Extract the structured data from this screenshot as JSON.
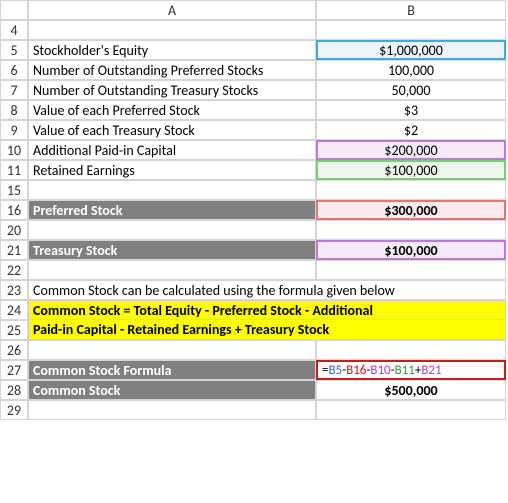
{
  "columns": {
    "rowcol": "",
    "A": "A",
    "B": "B"
  },
  "rows": {
    "4": {
      "A": "",
      "B": ""
    },
    "5": {
      "A": "Stockholder's Equity",
      "B": "$1,000,000"
    },
    "6": {
      "A": "Number of Outstanding Preferred Stocks",
      "B": "100,000"
    },
    "7": {
      "A": "Number of Outstanding Treasury Stocks",
      "B": "50,000"
    },
    "8": {
      "A": "Value of each Preferred Stock",
      "B": "$3"
    },
    "9": {
      "A": "Value of each Treasury Stock",
      "B": "$2"
    },
    "10": {
      "A": "Additional Paid-in Capital",
      "B": "$200,000"
    },
    "11": {
      "A": "Retained Earnings",
      "B": "$100,000"
    },
    "15": {
      "A": "",
      "B": ""
    },
    "16": {
      "A": "Preferred Stock",
      "B": "$300,000"
    },
    "20": {
      "A": "",
      "B": ""
    },
    "21": {
      "A": "Treasury Stock",
      "B": "$100,000"
    },
    "22": {
      "A": "",
      "B": ""
    },
    "23": {
      "A": "Common Stock can be calculated using the formula given below",
      "B": ""
    },
    "24": {
      "A": "Common Stock = Total Equity - Preferred Stock - Additional ",
      "B": ""
    },
    "25": {
      "A": "Paid-in Capital - Retained Earnings + Treasury Stock",
      "B": ""
    },
    "26": {
      "A": "",
      "B": ""
    },
    "27": {
      "A": "Common Stock Formula",
      "B_formula": {
        "eq": "=",
        "parts": [
          "B5",
          "-",
          "B16",
          "-",
          "B10",
          "-",
          "B11",
          "+",
          "B21"
        ]
      }
    },
    "28": {
      "A": "Common Stock",
      "B": "$500,000"
    },
    "29": {
      "A": "",
      "B": ""
    }
  },
  "chart_data": {
    "type": "table",
    "title": "Common Stock Calculation",
    "inputs": {
      "Stockholder's Equity": 1000000,
      "Number of Outstanding Preferred Stocks": 100000,
      "Number of Outstanding Treasury Stocks": 50000,
      "Value of each Preferred Stock": 3,
      "Value of each Treasury Stock": 2,
      "Additional Paid-in Capital": 200000,
      "Retained Earnings": 100000
    },
    "derived": {
      "Preferred Stock": 300000,
      "Treasury Stock": 100000,
      "Common Stock": 500000
    },
    "formula": "Common Stock = Total Equity - Preferred Stock - Additional Paid-in Capital - Retained Earnings + Treasury Stock",
    "cell_formula": "=B5-B16-B10-B11+B21"
  }
}
